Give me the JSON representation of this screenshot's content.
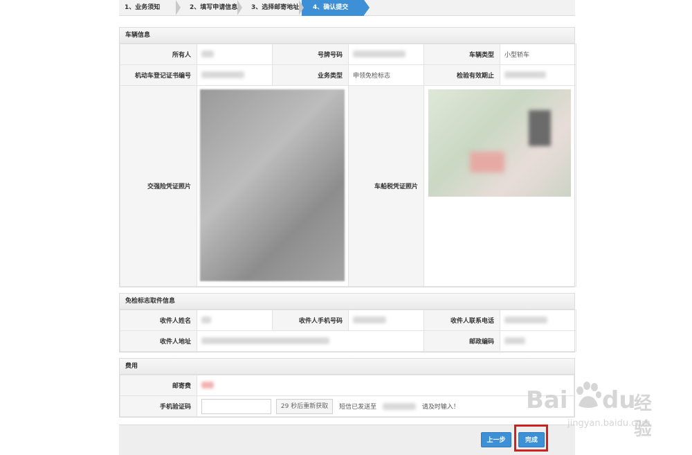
{
  "steps": [
    "1、业务须知",
    "2、填写申请信息",
    "3、选择邮寄地址",
    "4、确认提交"
  ],
  "vehicle_section": {
    "title": "车辆信息",
    "owner_label": "所有人",
    "plate_label": "号牌号码",
    "type_label": "车辆类型",
    "type_value": "小型轿车",
    "cert_label": "机动车登记证书编号",
    "biz_label": "业务类型",
    "biz_value": "申领免检标志",
    "valid_label": "检验有效期止",
    "insurance_label": "交强险凭证照片",
    "tax_label": "车船税凭证照片"
  },
  "delivery_section": {
    "title": "免检标志取件信息",
    "name_label": "收件人姓名",
    "mobile_label": "收件人手机号码",
    "phone_label": "收件人联系电话",
    "address_label": "收件人地址",
    "zip_label": "邮政编码"
  },
  "fee_section": {
    "title": "费用",
    "postage_label": "邮寄费",
    "code_label": "手机验证码",
    "resend_label": "29 秒后重新获取",
    "sms_sent": "短信已发送至",
    "sms_tip": "请及时输入！"
  },
  "buttons": {
    "prev": "上一步",
    "done": "完成"
  },
  "watermark": {
    "brand": "Bai",
    "brand2": "du",
    "cn": "经验",
    "url": "jingyan.baidu.com"
  },
  "colors": {
    "accent": "#3d8fd6",
    "highlight": "#d0201e"
  }
}
